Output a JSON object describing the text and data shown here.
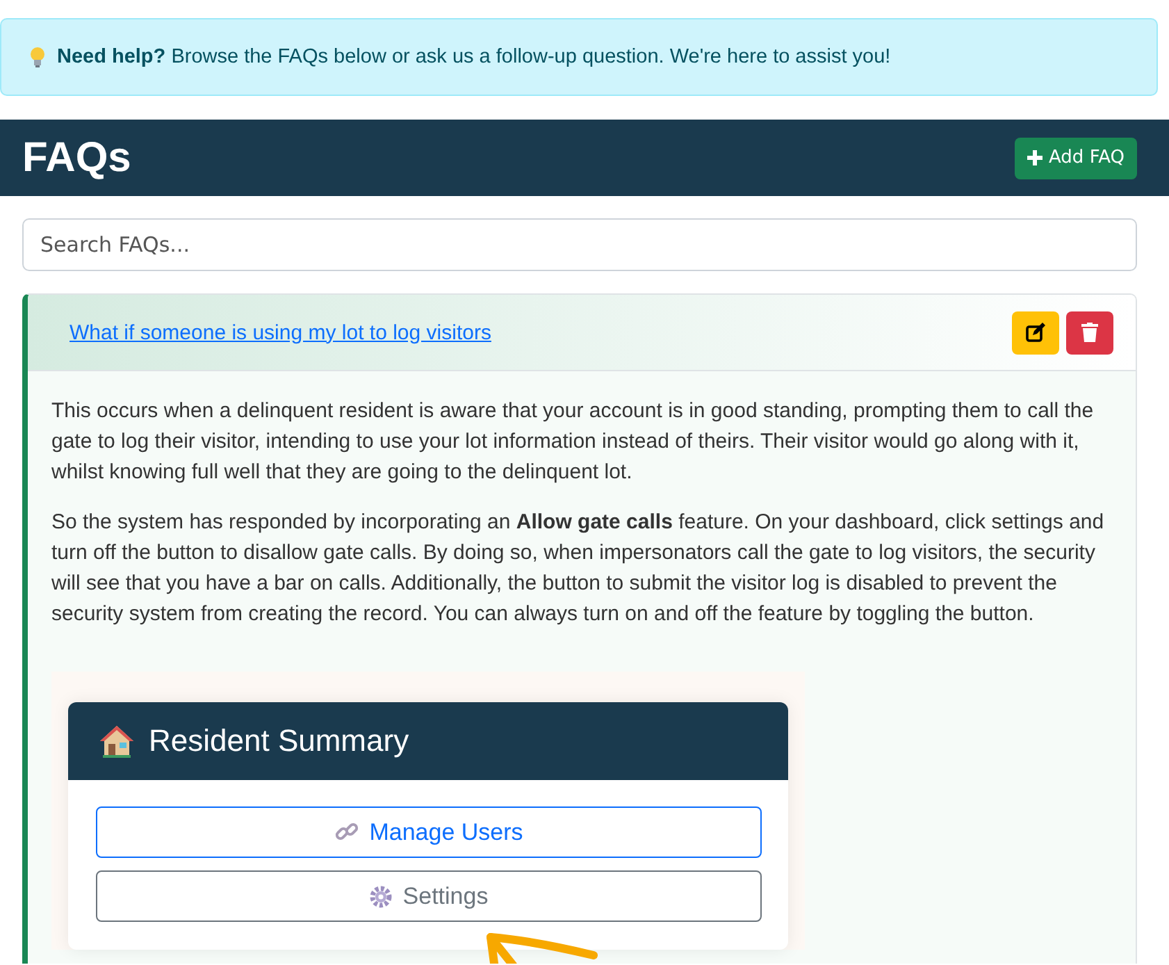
{
  "alert": {
    "title": "Need help?",
    "text": "Browse the FAQs below or ask us a follow-up question. We're here to assist you!"
  },
  "header": {
    "title": "FAQs",
    "add_button": "Add FAQ"
  },
  "search": {
    "placeholder": "Search FAQs..."
  },
  "faqs": [
    {
      "question": "What if someone is using my lot to log visitors",
      "expanded": true,
      "paragraphs": [
        "This occurs when a delinquent resident is aware that your account is in good standing, prompting them to call the gate to log their visitor, intending to use your lot information instead of theirs. Their visitor would go along with it, whilst knowing full well that they are going to the delinquent lot.",
        "So the system has responded by incorporating an **Allow gate calls** feature. On your dashboard, click settings and turn off the button to disallow gate calls. By doing so, when impersonators call the gate to log visitors, the security will see that you have a bar on calls. Additionally, the button to submit the visitor log is disabled to prevent the security system from creating the record. You can always turn on and off the feature by toggling the button."
      ],
      "screenshot": {
        "title": "Resident Summary",
        "buttons": [
          {
            "label": "Manage Users",
            "kind": "primary"
          },
          {
            "label": "Settings",
            "kind": "secondary"
          }
        ]
      }
    }
  ]
}
